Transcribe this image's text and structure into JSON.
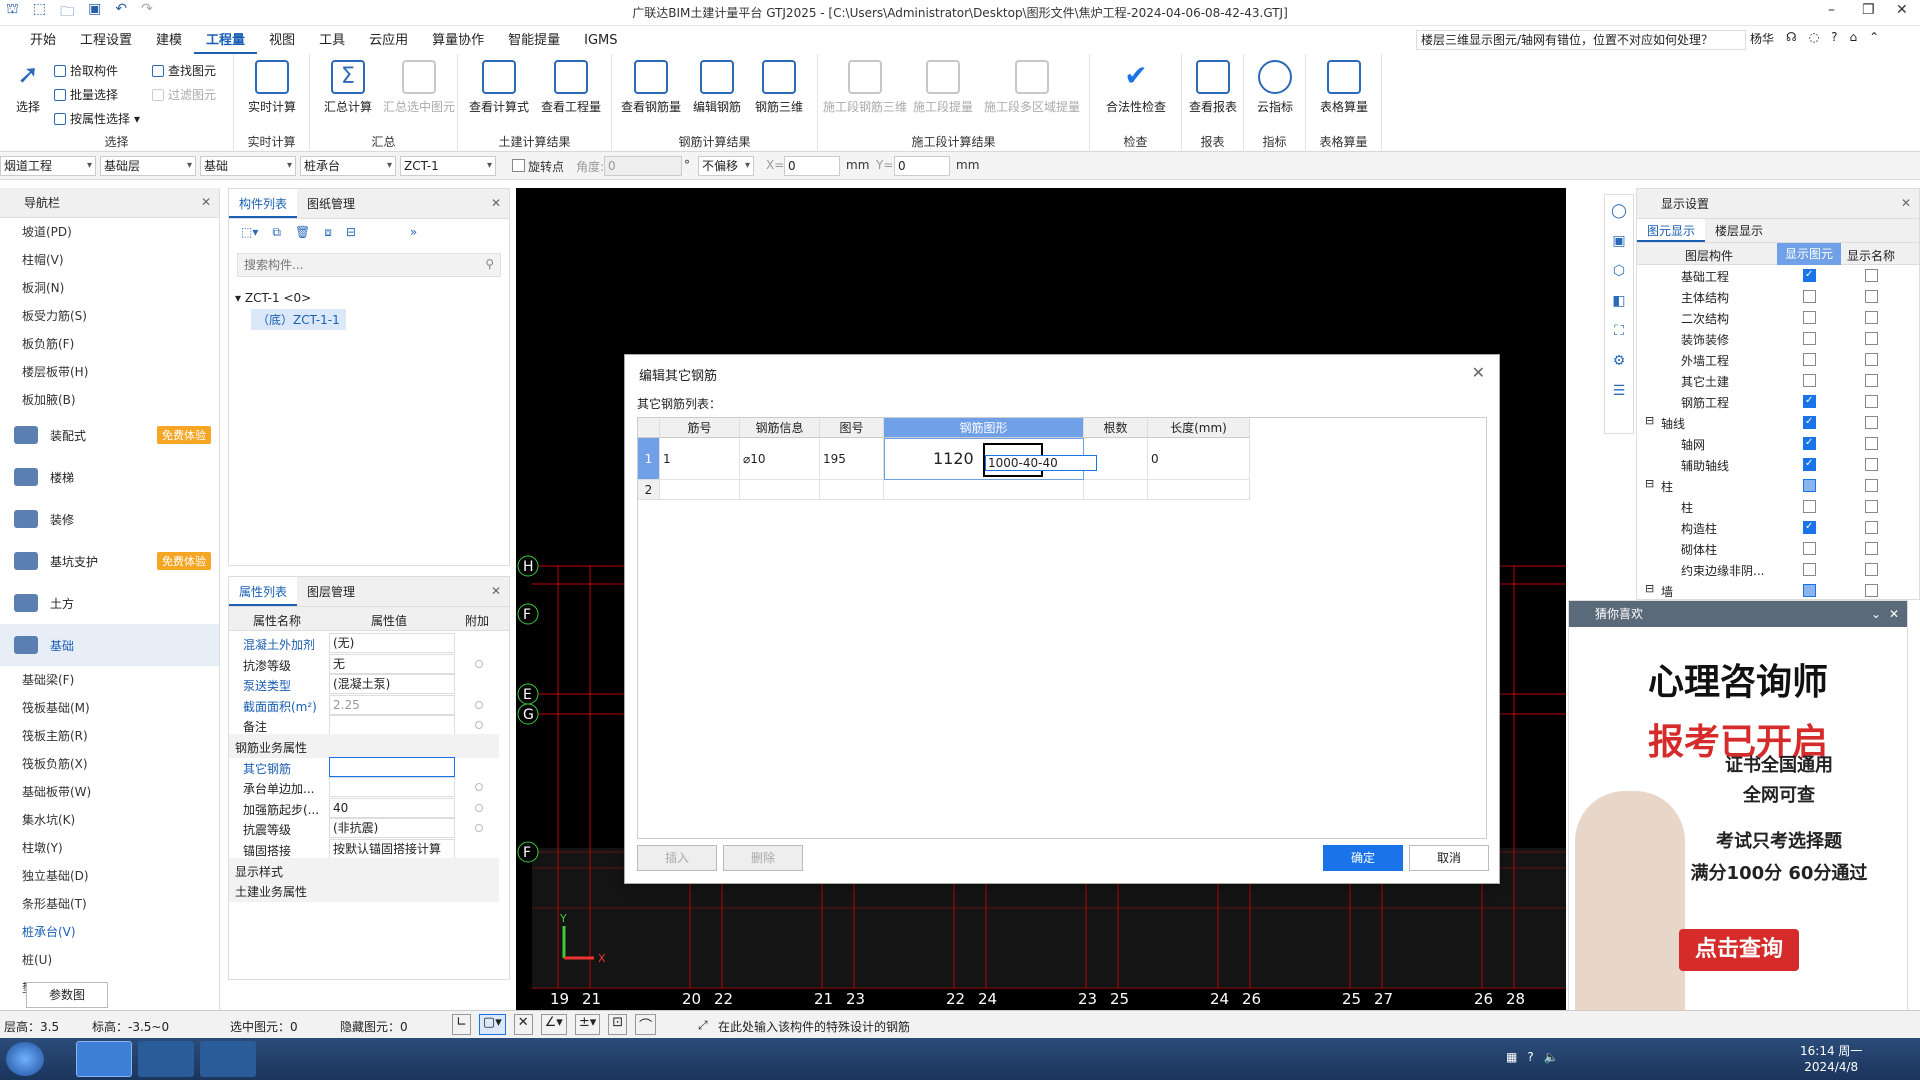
{
  "titlebar": {
    "title": "广联达BIM土建计量平台 GTJ2025 - [C:\\Users\\Administrator\\Desktop\\图形文件\\焦炉工程-2024-04-06-08-42-43.GTJ]"
  },
  "menubar": {
    "items": [
      "开始",
      "工程设置",
      "建模",
      "工程量",
      "视图",
      "工具",
      "云应用",
      "算量协作",
      "智能提量",
      "IGMS"
    ],
    "active": "工程量",
    "help_text": "楼层三维显示图元/轴网有错位，位置不对应如何处理？",
    "user": "杨华"
  },
  "ribbon": {
    "select": {
      "label": "选择",
      "pick": "拾取构件",
      "batch": "批量选择",
      "by_attr": "按属性选择",
      "find": "查找图元",
      "filter": "过滤图元",
      "group": "选择"
    },
    "calc": {
      "realtime": "实时计算",
      "group": "实时计算"
    },
    "summary": {
      "sum": "汇总计算",
      "sum_sel": "汇总选中图元",
      "group": "汇总"
    },
    "civil": {
      "formula": "查看计算式",
      "qty": "查看工程量",
      "group": "土建计算结果"
    },
    "rebar": {
      "view": "查看钢筋量",
      "edit": "编辑钢筋",
      "r3d": "钢筋三维",
      "group": "钢筋计算结果"
    },
    "stage": {
      "s3d": "施工段钢筋三维",
      "sqty": "施工段提量",
      "smulti": "施工段多区域提量",
      "group": "施工段计算结果"
    },
    "check": {
      "legal": "合法性检查",
      "group": "检查"
    },
    "report": {
      "view": "查看报表",
      "group": "报表"
    },
    "index": {
      "cloud": "云指标",
      "group": "指标"
    },
    "table": {
      "calc": "表格算量",
      "group": "表格算量"
    }
  },
  "toolrow": {
    "project": "烟道工程",
    "floor": "基础层",
    "category": "基础",
    "type": "桩承台",
    "name": "ZCT-1",
    "rotate": "旋转点",
    "angle_label": "角度:",
    "angle": "0",
    "offset": "不偏移",
    "x_label": "X=",
    "x": "0",
    "y_label": "Y=",
    "y": "0",
    "unit": "mm"
  },
  "nav": {
    "title": "导航栏",
    "top_items": [
      "坡道(PD)",
      "柱帽(V)",
      "板洞(N)",
      "板受力筋(S)",
      "板负筋(F)",
      "楼层板带(H)",
      "板加腋(B)"
    ],
    "categories": [
      {
        "label": "装配式",
        "badge": "免费体验"
      },
      {
        "label": "楼梯",
        "badge": ""
      },
      {
        "label": "装修",
        "badge": ""
      },
      {
        "label": "基坑支护",
        "badge": "免费体验"
      },
      {
        "label": "土方",
        "badge": ""
      },
      {
        "label": "基础",
        "badge": ""
      }
    ],
    "sub_items": [
      "基础梁(F)",
      "筏板基础(M)",
      "筏板主筋(R)",
      "筏板负筋(X)",
      "基础板带(W)",
      "集水坑(K)",
      "柱墩(Y)",
      "独立基础(D)",
      "条形基础(T)",
      "桩承台(V)",
      "桩(U)",
      "垫层(X)"
    ],
    "selected": "桩承台(V)"
  },
  "complist": {
    "tab1": "构件列表",
    "tab2": "图纸管理",
    "search_placeholder": "搜索构件...",
    "tree_root": "ZCT-1 <0>",
    "tree_child": "（底）ZCT-1-1"
  },
  "props": {
    "tab1": "属性列表",
    "tab2": "图层管理",
    "h_name": "属性名称",
    "h_value": "属性值",
    "h_extra": "附加",
    "rows": [
      {
        "n": "混凝土外加剂",
        "v": "(无)"
      },
      {
        "n": "抗渗等级",
        "v": "无"
      },
      {
        "n": "泵送类型",
        "v": "(混凝土泵)"
      },
      {
        "n": "截面面积(m²)",
        "v": "2.25"
      },
      {
        "n": "备注",
        "v": ""
      },
      {
        "n": "钢筋业务属性",
        "v": ""
      },
      {
        "n": "其它钢筋",
        "v": ""
      },
      {
        "n": "承台单边加...",
        "v": ""
      },
      {
        "n": "加强筋起步(...",
        "v": "40"
      },
      {
        "n": "抗震等级",
        "v": "(非抗震)"
      },
      {
        "n": "锚固搭接",
        "v": "按默认锚固搭接计算"
      },
      {
        "n": "显示样式",
        "v": ""
      },
      {
        "n": "土建业务属性",
        "v": ""
      }
    ],
    "param_btn": "参数图"
  },
  "viewport": {
    "axis_left": [
      "H",
      "F",
      "E",
      "G",
      "F"
    ],
    "axis_bottom": [
      "19",
      "21",
      "20",
      "22",
      "21",
      "23",
      "22",
      "24",
      "23",
      "25",
      "24",
      "26",
      "25",
      "27",
      "26",
      "28"
    ]
  },
  "display": {
    "title": "显示设置",
    "tab1": "图元显示",
    "tab2": "楼层显示",
    "h1": "图层构件",
    "h2": "显示图元",
    "h3": "显示名称",
    "rows": [
      {
        "n": "基础工程",
        "c1": "on",
        "lvl": 1
      },
      {
        "n": "主体结构",
        "c1": "",
        "lvl": 1
      },
      {
        "n": "二次结构",
        "c1": "",
        "lvl": 1
      },
      {
        "n": "装饰装修",
        "c1": "",
        "lvl": 1
      },
      {
        "n": "外墙工程",
        "c1": "",
        "lvl": 1
      },
      {
        "n": "其它土建",
        "c1": "",
        "lvl": 1
      },
      {
        "n": "钢筋工程",
        "c1": "on",
        "lvl": 1
      },
      {
        "n": "轴线",
        "c1": "on",
        "lvl": 0
      },
      {
        "n": "轴网",
        "c1": "on",
        "lvl": 1
      },
      {
        "n": "辅助轴线",
        "c1": "on",
        "lvl": 1
      },
      {
        "n": "柱",
        "c1": "part",
        "lvl": 0
      },
      {
        "n": "柱",
        "c1": "",
        "lvl": 1
      },
      {
        "n": "构造柱",
        "c1": "on",
        "lvl": 1
      },
      {
        "n": "砌体柱",
        "c1": "",
        "lvl": 1
      },
      {
        "n": "约束边缘非阴...",
        "c1": "",
        "lvl": 1
      },
      {
        "n": "墙",
        "c1": "part",
        "lvl": 0
      }
    ]
  },
  "ad": {
    "head": "猜你喜欢",
    "l1": "心理咨询师",
    "l2": "报考已开启",
    "l3": "证书全国通用",
    "l4": "全网可查",
    "l5": "考试只考选择题",
    "l6": "满分100分 60分通过",
    "btn": "点击查询"
  },
  "dialog": {
    "title": "编辑其它钢筋",
    "list_label": "其它钢筋列表：",
    "headers": [
      "筋号",
      "钢筋信息",
      "图号",
      "钢筋图形",
      "根数",
      "长度(mm)"
    ],
    "row1": {
      "idx": "1",
      "num": "1",
      "info": "⌀10",
      "fig": "195",
      "len_label": "1120",
      "shape_input": "1000-40-40",
      "count": "",
      "length": "0"
    },
    "row2": {
      "idx": "2"
    },
    "insert": "插入",
    "delete": "删除",
    "ok": "确定",
    "cancel": "取消"
  },
  "statusbar": {
    "floor_h": "层高：3.5",
    "elev": "标高：-3.5~0",
    "sel": "选中图元：0",
    "hidden": "隐藏图元：0",
    "hint": "在此处输入该构件的特殊设计的钢筋"
  },
  "taskbar": {
    "time": "16:14 周一",
    "date": "2024/4/8"
  },
  "colors": {
    "accent": "#1a73e8",
    "axis_red": "#c00000",
    "axis_green": "#3bcc3b",
    "ad_red": "#d62b2b"
  }
}
